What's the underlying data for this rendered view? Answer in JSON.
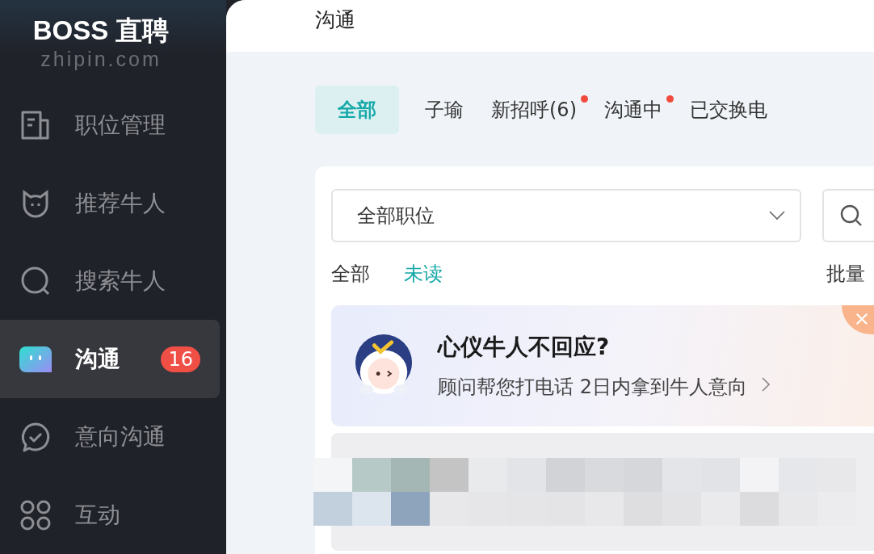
{
  "logo": {
    "title": "BOSS 直聘",
    "domain": "zhipin.com"
  },
  "sidebar": {
    "items": [
      {
        "label": "职位管理",
        "selected": false
      },
      {
        "label": "推荐牛人",
        "selected": false
      },
      {
        "label": "搜索牛人",
        "selected": false
      },
      {
        "label": "沟通",
        "selected": true,
        "badge": "16"
      },
      {
        "label": "意向沟通",
        "selected": false
      },
      {
        "label": "互动",
        "selected": false
      }
    ]
  },
  "header": {
    "title": "沟通"
  },
  "tabs": [
    {
      "label": "全部",
      "selected": true,
      "dot": false
    },
    {
      "label": "子瑜",
      "selected": false,
      "dot": false
    },
    {
      "label": "新招呼(6)",
      "selected": false,
      "dot": true
    },
    {
      "label": "沟通中",
      "selected": false,
      "dot": true
    },
    {
      "label": "已交换电",
      "selected": false,
      "dot": false
    }
  ],
  "job_select": {
    "value": "全部职位"
  },
  "filters": [
    {
      "label": "全部",
      "selected": false
    },
    {
      "label": "未读",
      "selected": true
    }
  ],
  "batch_label": "批量",
  "banner": {
    "title": "心仪牛人不回应?",
    "subtitle": "顾问帮您打电话 2日内拿到牛人意向"
  }
}
